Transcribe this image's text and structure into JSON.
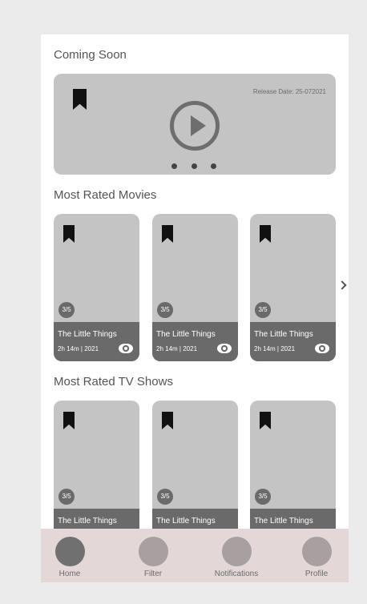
{
  "sections": {
    "coming_soon": "Coming Soon",
    "most_rated_movies": "Most Rated Movies",
    "most_rated_tv": "Most Rated TV Shows"
  },
  "hero": {
    "release_date": "Release Date: 25-072021",
    "carousel_pages": 3
  },
  "movies": [
    {
      "title": "The Little Things",
      "duration": "2h 14m",
      "year": "2021",
      "rating": "3/5"
    },
    {
      "title": "The Little Things",
      "duration": "2h 14m",
      "year": "2021",
      "rating": "3/5"
    },
    {
      "title": "The Little Things",
      "duration": "2h 14m",
      "year": "2021",
      "rating": "3/5"
    }
  ],
  "tv_shows": [
    {
      "title": "The Little Things",
      "rating": "3/5"
    },
    {
      "title": "The Little Things",
      "rating": "3/5"
    },
    {
      "title": "The Little Things",
      "rating": "3/5"
    }
  ],
  "nav": [
    {
      "label": "Home",
      "active": true
    },
    {
      "label": "Filter",
      "active": false
    },
    {
      "label": "Notifications",
      "active": false
    },
    {
      "label": "Profile",
      "active": false
    }
  ],
  "colors": {
    "page_background": "#ebebeb",
    "card_gray": "#c4c4c4",
    "card_footer": "#6a6a6a",
    "nav_background": "#e4d7d7",
    "nav_active": "#707070",
    "nav_inactive": "#a8a0a0"
  },
  "icons": {
    "bookmark": "bookmark-icon",
    "play": "play-icon",
    "eye": "eye-icon",
    "next": "chevron-right-icon"
  }
}
